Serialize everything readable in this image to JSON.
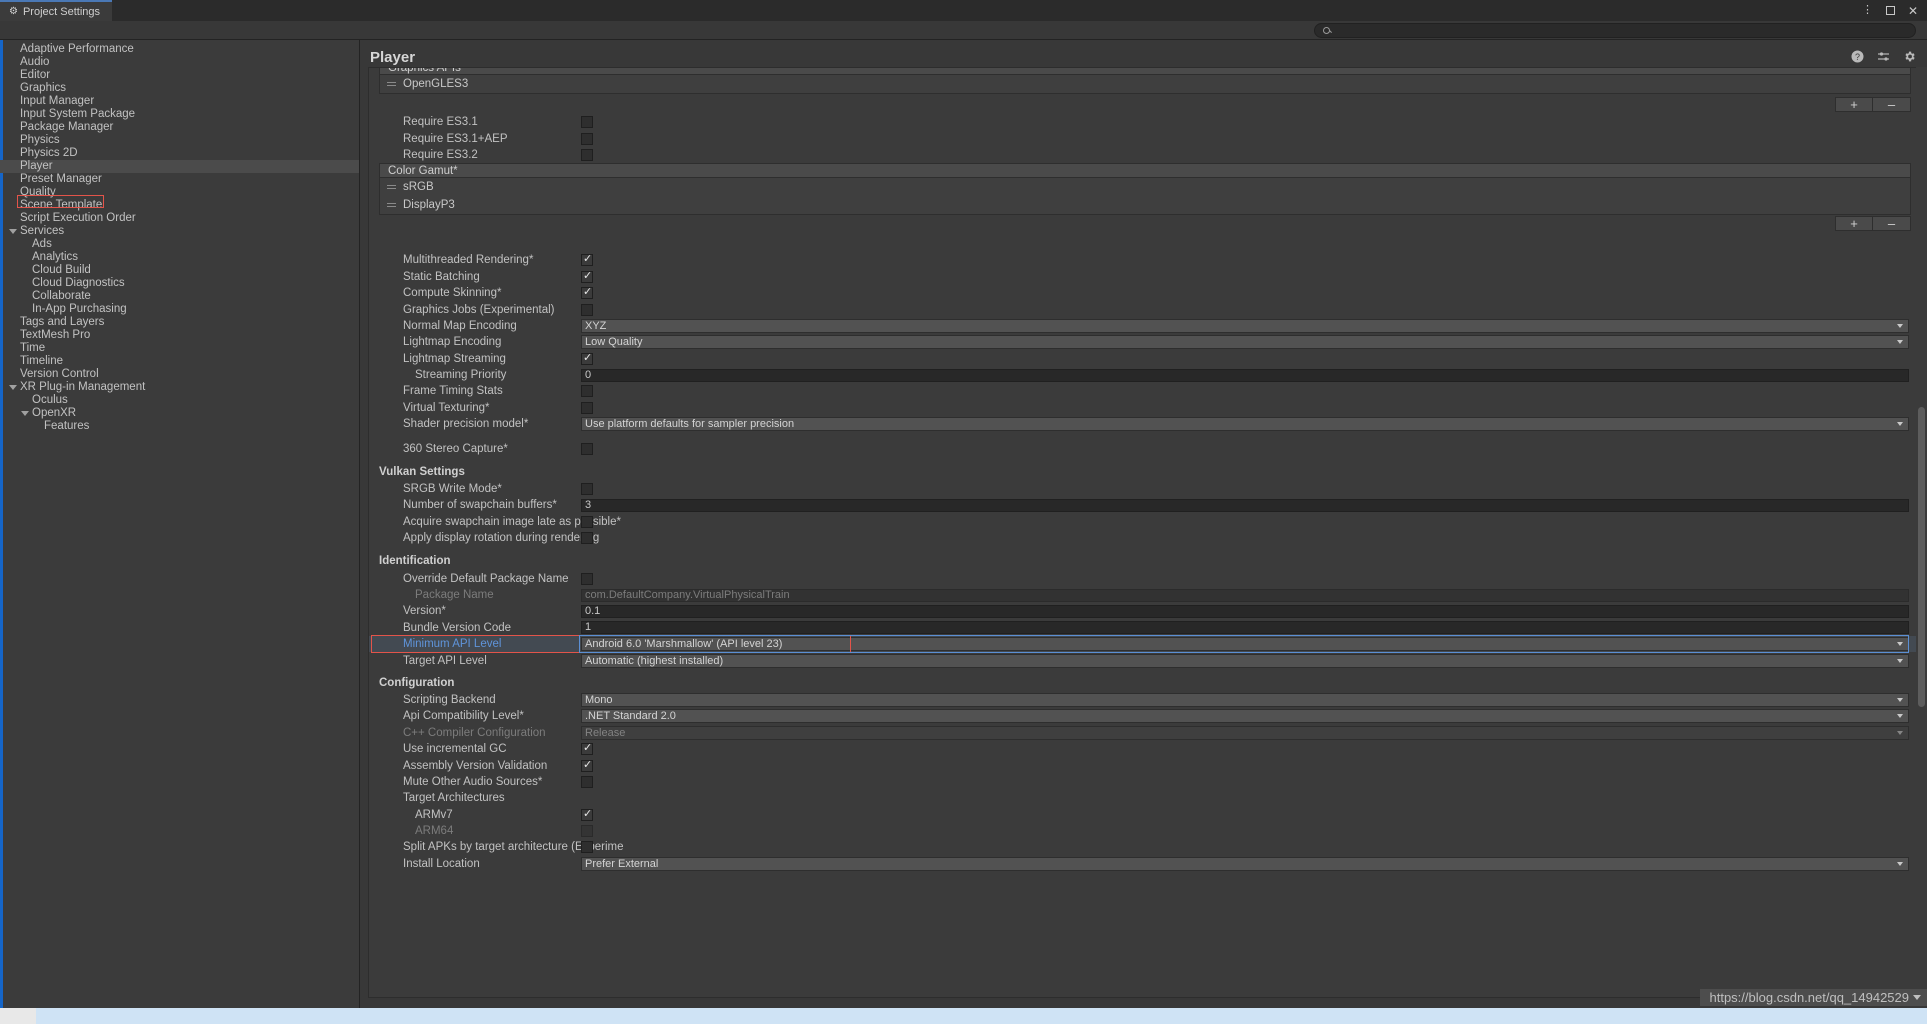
{
  "window": {
    "tab_title": "Project Settings",
    "tab_icon": "gear-icon",
    "controls": {
      "menu": "⋮",
      "maximize": "□",
      "close": "✕"
    }
  },
  "search": {
    "placeholder": "",
    "value": "",
    "icon": "search-icon"
  },
  "sidebar": {
    "items": [
      {
        "label": "Adaptive Performance",
        "depth": 0,
        "expandable": false,
        "selected": false
      },
      {
        "label": "Audio",
        "depth": 0,
        "expandable": false,
        "selected": false
      },
      {
        "label": "Editor",
        "depth": 0,
        "expandable": false,
        "selected": false
      },
      {
        "label": "Graphics",
        "depth": 0,
        "expandable": false,
        "selected": false
      },
      {
        "label": "Input Manager",
        "depth": 0,
        "expandable": false,
        "selected": false
      },
      {
        "label": "Input System Package",
        "depth": 0,
        "expandable": false,
        "selected": false
      },
      {
        "label": "Package Manager",
        "depth": 0,
        "expandable": false,
        "selected": false
      },
      {
        "label": "Physics",
        "depth": 0,
        "expandable": false,
        "selected": false
      },
      {
        "label": "Physics 2D",
        "depth": 0,
        "expandable": false,
        "selected": false
      },
      {
        "label": "Player",
        "depth": 0,
        "expandable": false,
        "selected": true
      },
      {
        "label": "Preset Manager",
        "depth": 0,
        "expandable": false,
        "selected": false
      },
      {
        "label": "Quality",
        "depth": 0,
        "expandable": false,
        "selected": false
      },
      {
        "label": "Scene Template",
        "depth": 0,
        "expandable": false,
        "selected": false
      },
      {
        "label": "Script Execution Order",
        "depth": 0,
        "expandable": false,
        "selected": false
      },
      {
        "label": "Services",
        "depth": 0,
        "expandable": true,
        "selected": false
      },
      {
        "label": "Ads",
        "depth": 1,
        "expandable": false,
        "selected": false
      },
      {
        "label": "Analytics",
        "depth": 1,
        "expandable": false,
        "selected": false
      },
      {
        "label": "Cloud Build",
        "depth": 1,
        "expandable": false,
        "selected": false
      },
      {
        "label": "Cloud Diagnostics",
        "depth": 1,
        "expandable": false,
        "selected": false
      },
      {
        "label": "Collaborate",
        "depth": 1,
        "expandable": false,
        "selected": false
      },
      {
        "label": "In-App Purchasing",
        "depth": 1,
        "expandable": false,
        "selected": false
      },
      {
        "label": "Tags and Layers",
        "depth": 0,
        "expandable": false,
        "selected": false
      },
      {
        "label": "TextMesh Pro",
        "depth": 0,
        "expandable": false,
        "selected": false
      },
      {
        "label": "Time",
        "depth": 0,
        "expandable": false,
        "selected": false
      },
      {
        "label": "Timeline",
        "depth": 0,
        "expandable": false,
        "selected": false
      },
      {
        "label": "Version Control",
        "depth": 0,
        "expandable": false,
        "selected": false
      },
      {
        "label": "XR Plug-in Management",
        "depth": 0,
        "expandable": true,
        "selected": false
      },
      {
        "label": "Oculus",
        "depth": 1,
        "expandable": false,
        "selected": false
      },
      {
        "label": "OpenXR",
        "depth": 1,
        "expandable": true,
        "selected": false
      },
      {
        "label": "Features",
        "depth": 2,
        "expandable": false,
        "selected": false
      }
    ]
  },
  "header": {
    "title": "Player",
    "icons": [
      "help-icon",
      "preset-icon",
      "gear-icon"
    ]
  },
  "inspector": {
    "graphics_apis": {
      "header": "Graphics APIs",
      "items": [
        "OpenGLES3"
      ],
      "add_label": "+",
      "remove_label": "–"
    },
    "es_requirements": [
      {
        "label": "Require ES3.1",
        "checked": false
      },
      {
        "label": "Require ES3.1+AEP",
        "checked": false
      },
      {
        "label": "Require ES3.2",
        "checked": false
      }
    ],
    "color_gamut": {
      "header": "Color Gamut*",
      "items": [
        "sRGB",
        "DisplayP3"
      ],
      "add_label": "+",
      "remove_label": "–"
    },
    "rendering": [
      {
        "label": "Multithreaded Rendering*",
        "type": "checkbox",
        "checked": true,
        "indent": 1
      },
      {
        "label": "Static Batching",
        "type": "checkbox",
        "checked": true,
        "indent": 1
      },
      {
        "label": "Compute Skinning*",
        "type": "checkbox",
        "checked": true,
        "indent": 1
      },
      {
        "label": "Graphics Jobs (Experimental)",
        "type": "checkbox",
        "checked": false,
        "indent": 1
      },
      {
        "label": "Normal Map Encoding",
        "type": "dropdown",
        "value": "XYZ",
        "indent": 1
      },
      {
        "label": "Lightmap Encoding",
        "type": "dropdown",
        "value": "Low Quality",
        "indent": 1
      },
      {
        "label": "Lightmap Streaming",
        "type": "checkbox",
        "checked": true,
        "indent": 1
      },
      {
        "label": "Streaming Priority",
        "type": "text",
        "value": "0",
        "indent": 2
      },
      {
        "label": "Frame Timing Stats",
        "type": "checkbox",
        "checked": false,
        "indent": 1
      },
      {
        "label": "Virtual Texturing*",
        "type": "checkbox",
        "checked": false,
        "indent": 1
      },
      {
        "label": "Shader precision model*",
        "type": "dropdown",
        "value": "Use platform defaults for sampler precision",
        "indent": 1
      },
      {
        "label": "",
        "type": "spacer",
        "indent": 1
      },
      {
        "label": "360 Stereo Capture*",
        "type": "checkbox",
        "checked": false,
        "indent": 1
      }
    ],
    "vulkan": {
      "header": "Vulkan Settings",
      "rows": [
        {
          "label": "SRGB Write Mode*",
          "type": "checkbox",
          "checked": false,
          "indent": 1
        },
        {
          "label": "Number of swapchain buffers*",
          "type": "text",
          "value": "3",
          "indent": 1
        },
        {
          "label": "Acquire swapchain image late as possible*",
          "type": "checkbox",
          "checked": false,
          "indent": 1
        },
        {
          "label": "Apply display rotation during rendering",
          "type": "checkbox",
          "checked": false,
          "indent": 1
        }
      ]
    },
    "identification": {
      "header": "Identification",
      "rows": [
        {
          "label": "Override Default Package Name",
          "type": "checkbox",
          "checked": false,
          "indent": 1
        },
        {
          "label": "Package Name",
          "type": "text",
          "value": "com.DefaultCompany.VirtualPhysicalTrain",
          "indent": 2,
          "disabled": true
        },
        {
          "label": "Version*",
          "type": "text",
          "value": "0.1",
          "indent": 1
        },
        {
          "label": "Bundle Version Code",
          "type": "text",
          "value": "1",
          "indent": 1
        },
        {
          "label": "Minimum API Level",
          "type": "dropdown",
          "value": "Android 6.0 'Marshmallow' (API level 23)",
          "indent": 1,
          "highlighted": true
        },
        {
          "label": "Target API Level",
          "type": "dropdown",
          "value": "Automatic (highest installed)",
          "indent": 1
        }
      ]
    },
    "configuration": {
      "header": "Configuration",
      "rows": [
        {
          "label": "Scripting Backend",
          "type": "dropdown",
          "value": "Mono",
          "indent": 1
        },
        {
          "label": "Api Compatibility Level*",
          "type": "dropdown",
          "value": ".NET Standard 2.0",
          "indent": 1
        },
        {
          "label": "C++ Compiler Configuration",
          "type": "dropdown",
          "value": "Release",
          "indent": 1,
          "disabled": true
        },
        {
          "label": "Use incremental GC",
          "type": "checkbox",
          "checked": true,
          "indent": 1
        },
        {
          "label": "Assembly Version Validation",
          "type": "checkbox",
          "checked": true,
          "indent": 1
        },
        {
          "label": "Mute Other Audio Sources*",
          "type": "checkbox",
          "checked": false,
          "indent": 1
        },
        {
          "label": "Target Architectures",
          "type": "label",
          "indent": 1
        },
        {
          "label": "ARMv7",
          "type": "checkbox",
          "checked": true,
          "indent": 2
        },
        {
          "label": "ARM64",
          "type": "checkbox",
          "checked": false,
          "indent": 2,
          "disabled": true
        },
        {
          "label": "Split APKs by target architecture (Experime",
          "type": "checkbox",
          "checked": false,
          "indent": 1
        },
        {
          "label": "Install Location",
          "type": "dropdown",
          "value": "Prefer External",
          "indent": 1
        }
      ]
    }
  },
  "watermark": {
    "text": "https://blog.csdn.net/qq_14942529"
  },
  "colors": {
    "accent_blue": "#4a78b5",
    "highlight_red": "#e3544a",
    "highlight_blue": "#5b8fd4",
    "panel_bg": "#3b3b3b",
    "window_bg": "#383838",
    "text": "#c2c2c2"
  }
}
